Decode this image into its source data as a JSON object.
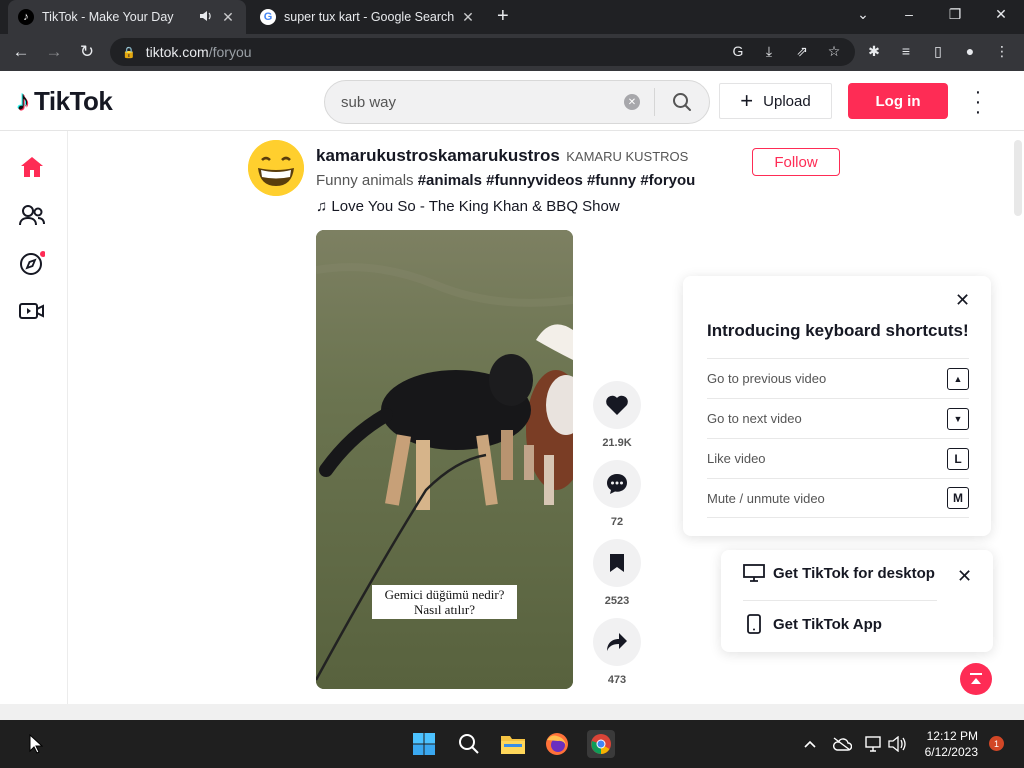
{
  "browser": {
    "tabs": [
      {
        "title": "TikTok - Make Your Day",
        "active": true
      },
      {
        "title": "super tux kart - Google Search",
        "active": false
      }
    ],
    "url_host": "tiktok.com",
    "url_path": "/foryou"
  },
  "header": {
    "logo_text": "TikTok",
    "search_value": "sub way",
    "upload_label": "Upload",
    "login_label": "Log in"
  },
  "post": {
    "author": "kamarukustroskamarukustros",
    "nickname": "KAMARU KUSTROS",
    "caption_text": "Funny animals",
    "hashtags": [
      "#animals",
      "#funnyvideos",
      "#funny",
      "#foryou"
    ],
    "music": "Love You So - The King Khan & BBQ Show",
    "follow_label": "Follow",
    "video_caption_line1": "Gemici düğümü nedir?",
    "video_caption_line2": "Nasıl atılır?",
    "likes": "21.9K",
    "comments": "72",
    "saves": "2523",
    "shares": "473"
  },
  "shortcuts": {
    "title": "Introducing keyboard shortcuts!",
    "items": [
      {
        "label": "Go to previous video",
        "key": "▲"
      },
      {
        "label": "Go to next video",
        "key": "▼"
      },
      {
        "label": "Like video",
        "key": "L"
      },
      {
        "label": "Mute / unmute video",
        "key": "M"
      }
    ]
  },
  "get_app": {
    "desktop_label": "Get TikTok for desktop",
    "app_label": "Get TikTok App"
  },
  "taskbar": {
    "time": "12:12 PM",
    "date": "6/12/2023",
    "notifications": "1"
  },
  "colors": {
    "brand": "#fe2c55",
    "chrome_dark": "#202124"
  }
}
